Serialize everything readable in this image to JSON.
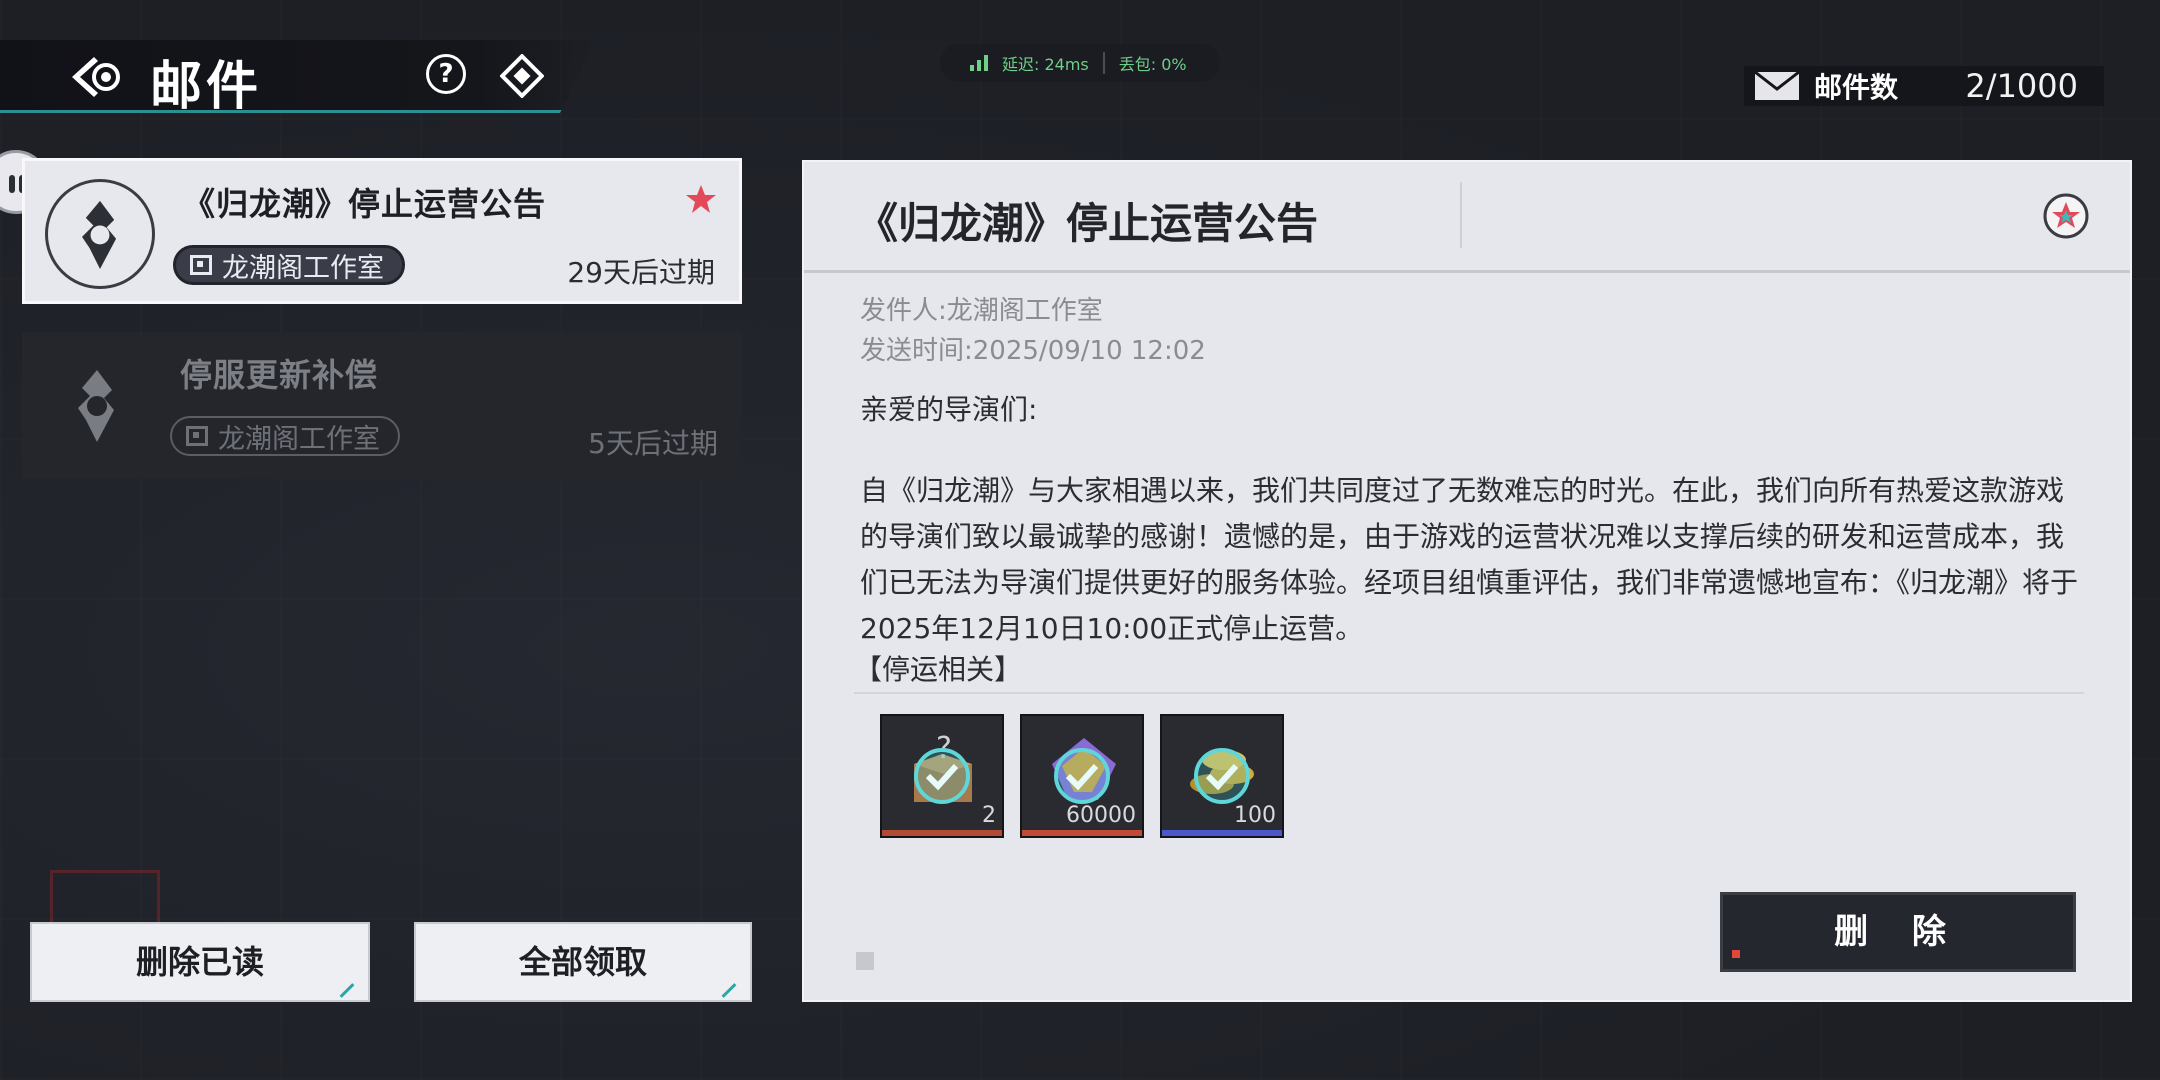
{
  "header": {
    "title": "邮件",
    "back_icon": "back-eye-icon",
    "help_icon": "help-icon",
    "help_text": "?",
    "diamond_icon": "diamond-icon"
  },
  "net": {
    "latency": "延迟: 24ms",
    "packet_loss": "丢包: 0%"
  },
  "mail_count": {
    "label": "邮件数",
    "value": "2/1000"
  },
  "mails": [
    {
      "title": "《归龙潮》停止运营公告",
      "sender": "龙潮阁工作室",
      "expire": "29天后过期",
      "starred": true
    },
    {
      "title": "停服更新补偿",
      "sender": "龙潮阁工作室",
      "expire": "5天后过期",
      "starred": false
    }
  ],
  "buttons": {
    "delete_read": "删除已读",
    "claim_all": "全部领取",
    "delete": "删 除"
  },
  "detail": {
    "title": "《归龙潮》停止运营公告",
    "sender": "发件人:龙潮阁工作室",
    "sent_time": "发送时间:2025/09/10 12:02",
    "greeting": "亲爱的导演们:",
    "body": "自《归龙潮》与大家相遇以来，我们共同度过了无数难忘的时光。在此，我们向所有热爱这款游戏的导演们致以最诚挚的感谢！遗憾的是，由于游戏的运营状况难以支撑后续的研发和运营成本，我们已无法为导演们提供更好的服务体验。经项目组慎重评估，我们非常遗憾地宣布：《归龙潮》将于2025年12月10日10:00正式停止运营。",
    "section": "【停运相关】"
  },
  "attachments": [
    {
      "name": "mystery-box",
      "qty": "2",
      "claimed": true
    },
    {
      "name": "gem-currency",
      "qty": "60000",
      "claimed": true
    },
    {
      "name": "gold-coins",
      "qty": "100",
      "claimed": true
    }
  ],
  "colors": {
    "accent": "#2e8f93",
    "star": "#e24a5a",
    "check": "#5fd6d8"
  }
}
